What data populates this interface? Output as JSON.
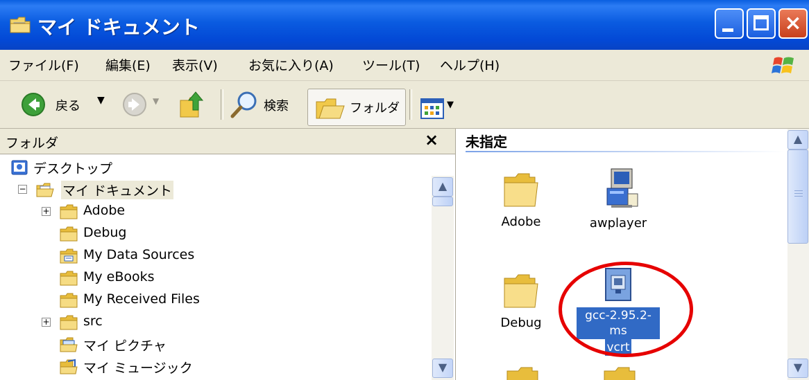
{
  "window": {
    "title": "マイ ドキュメント",
    "icon": "my-documents-folder-icon",
    "buttons": {
      "minimize": "minimize-icon",
      "maximize": "maximize-icon",
      "close": "×"
    }
  },
  "menu": {
    "items": [
      {
        "label": "ファイル(F)"
      },
      {
        "label": "編集(E)"
      },
      {
        "label": "表示(V)"
      },
      {
        "label": "お気に入り(A)"
      },
      {
        "label": "ツール(T)"
      },
      {
        "label": "ヘルプ(H)"
      }
    ]
  },
  "toolbar": {
    "back_label": "戻る",
    "search_label": "検索",
    "folders_label": "フォルダ"
  },
  "left_pane": {
    "title": "フォルダ",
    "close": "×",
    "tree": [
      {
        "label": "デスクトップ",
        "icon": "desktop-icon"
      },
      {
        "label": "マイ ドキュメント",
        "icon": "my-documents-icon",
        "expander": "−",
        "selected": true
      },
      {
        "label": "Adobe",
        "icon": "folder-icon",
        "expander": "+"
      },
      {
        "label": "Debug",
        "icon": "folder-icon"
      },
      {
        "label": "My Data Sources",
        "icon": "data-source-folder-icon"
      },
      {
        "label": "My eBooks",
        "icon": "folder-icon"
      },
      {
        "label": "My Received Files",
        "icon": "folder-icon"
      },
      {
        "label": "src",
        "icon": "folder-icon",
        "expander": "+"
      },
      {
        "label": "マイ ピクチャ",
        "icon": "my-pictures-icon"
      },
      {
        "label": "マイ ミュージック",
        "icon": "my-music-icon"
      }
    ]
  },
  "right_pane": {
    "column_header": "未指定",
    "files": [
      {
        "label": "Adobe",
        "icon": "folder-icon"
      },
      {
        "label": "awplayer",
        "icon": "setup-program-icon"
      },
      {
        "label": "Debug",
        "icon": "folder-icon"
      },
      {
        "label": "gcc-2.95.2-ms",
        "label2": "vcrt",
        "icon": "system-file-icon",
        "selected": true
      }
    ]
  },
  "colors": {
    "titlebar": "#0a5be0",
    "selection": "#316ac5",
    "highlight_circle": "#e60000",
    "chrome": "#ece9d8"
  }
}
